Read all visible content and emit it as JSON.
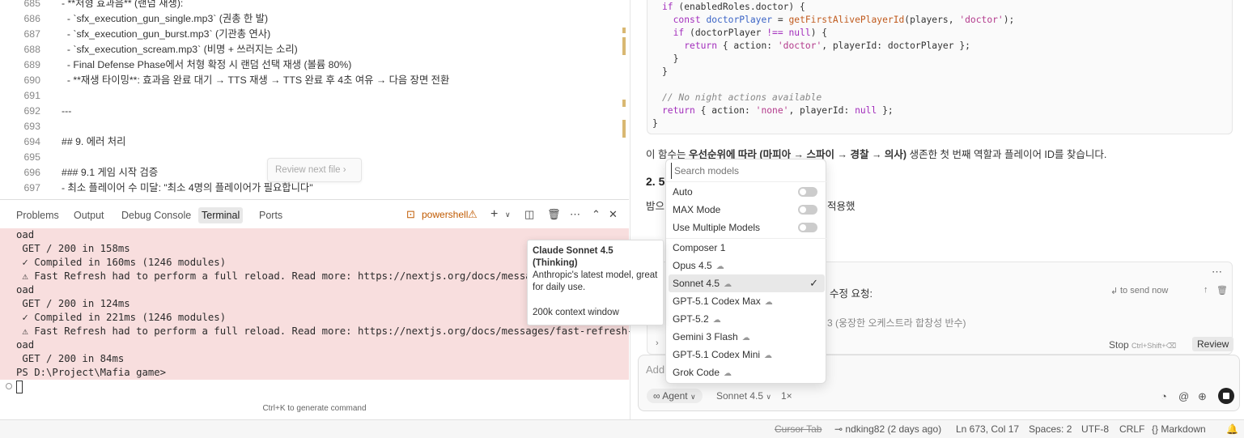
{
  "editor": {
    "lines": [
      {
        "num": "685",
        "text": "- **처형 효과음** (랜덤 재생):"
      },
      {
        "num": "686",
        "text": "  - `sfx_execution_gun_single.mp3` (권총 한 발)"
      },
      {
        "num": "687",
        "text": "  - `sfx_execution_gun_burst.mp3` (기관총 연사)"
      },
      {
        "num": "688",
        "text": "  - `sfx_execution_scream.mp3` (비명 + 쓰러지는 소리)"
      },
      {
        "num": "689",
        "text": "  - Final Defense Phase에서 처형 확정 시 랜덤 선택 재생 (볼륨 80%)"
      },
      {
        "num": "690",
        "text": "  - **재생 타이밍**: 효과음 완료 대기 → TTS 재생 → TTS 완료 후 4초 여유 → 다음 장면 전환"
      },
      {
        "num": "691",
        "text": ""
      },
      {
        "num": "692",
        "text": "---"
      },
      {
        "num": "693",
        "text": ""
      },
      {
        "num": "694",
        "text": "## 9. 에러 처리"
      },
      {
        "num": "695",
        "text": ""
      },
      {
        "num": "696",
        "text": "### 9.1 게임 시작 검증"
      },
      {
        "num": "697",
        "text": "- 최소 플레이어 수 미달: \"최소 4명의 플레이어가 필요합니다\""
      }
    ],
    "review_next_file": "Review next file"
  },
  "panel": {
    "tabs": [
      "Problems",
      "Output",
      "Debug Console",
      "Terminal",
      "Ports"
    ],
    "active_tab": "Terminal",
    "shell": "powershell",
    "terminal_lines": [
      "oad",
      " GET / 200 in 158ms",
      " ✓ Compiled in 160ms (1246 modules)",
      " ⚠ Fast Refresh had to perform a full reload. Read more: https://nextjs.org/docs/messages/fast-refresh-rel",
      "oad",
      " GET / 200 in 124ms",
      " ✓ Compiled in 221ms (1246 modules)",
      " ⚠ Fast Refresh had to perform a full reload. Read more: https://nextjs.org/docs/messages/fast-refresh-rel",
      "oad",
      " GET / 200 in 84ms",
      "PS D:\\Project\\Mafia game>"
    ],
    "generate_hint": "Ctrl+K to generate command"
  },
  "chat": {
    "code_lines": [
      "if (enabledRoles.doctor) {",
      "  const doctorPlayer = getFirstAlivePlayerId(players, 'doctor');",
      "  if (doctorPlayer !== null) {",
      "    return { action: 'doctor', playerId: doctorPlayer };",
      "  }",
      "}",
      "",
      "// No night actions available",
      "return { action: 'none', playerId: null };",
      "}"
    ],
    "description_prefix": "이 함수는 ",
    "description_bold1": "우선순위에 따라",
    "description_mid": " ",
    "description_bold2": "(마피아 → 스파이 → 경찰 → 의사)",
    "description_suffix": " 생존한 첫 번째 역할과 플레이어 ID를 찾습니다.",
    "section_heading": "2. 5",
    "section_text_left": "밤으",
    "section_text_right": "적용했",
    "queue": {
      "label": "수정 요청:",
      "send_now": "to send now",
      "item_text": "3 (웅장한 오케스트라 합창성 반수)",
      "stop_label": "Stop",
      "stop_shortcut": "Ctrl+Shift+⌫",
      "review_label": "Review"
    },
    "input_placeholder": "Add",
    "agent_label": "Agent",
    "model_label": "Sonnet 4.5",
    "multiplier": "1×"
  },
  "model_dropdown": {
    "search_placeholder": "Search models",
    "toggles": [
      {
        "label": "Auto",
        "on": false
      },
      {
        "label": "MAX Mode",
        "on": false
      },
      {
        "label": "Use Multiple Models",
        "on": false
      }
    ],
    "models": [
      {
        "label": "Composer 1",
        "thinking": false,
        "selected": false
      },
      {
        "label": "Opus 4.5",
        "thinking": true,
        "selected": false
      },
      {
        "label": "Sonnet 4.5",
        "thinking": true,
        "selected": true
      },
      {
        "label": "GPT-5.1 Codex Max",
        "thinking": true,
        "selected": false
      },
      {
        "label": "GPT-5.2",
        "thinking": true,
        "selected": false
      },
      {
        "label": "Gemini 3 Flash",
        "thinking": true,
        "selected": false
      },
      {
        "label": "GPT-5.1 Codex Mini",
        "thinking": true,
        "selected": false
      },
      {
        "label": "Grok Code",
        "thinking": true,
        "selected": false
      }
    ]
  },
  "tooltip": {
    "title": "Claude Sonnet 4.5",
    "subtitle": "(Thinking)",
    "description": "Anthropic's latest model, great for daily use.",
    "context": "200k context window"
  },
  "status_bar": {
    "cursor_tab": "Cursor Tab",
    "git": "ndking82 (2 days ago)",
    "position": "Ln 673, Col 17",
    "spaces": "Spaces: 2",
    "encoding": "UTF-8",
    "eol": "CRLF",
    "language": "Markdown"
  }
}
